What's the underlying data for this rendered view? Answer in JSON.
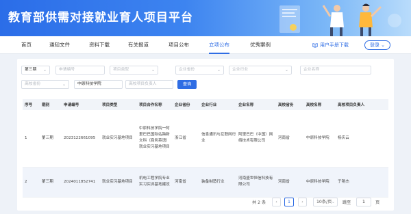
{
  "header": {
    "title": "教育部供需对接就业育人项目平台"
  },
  "nav": {
    "items": [
      "首页",
      "通知文件",
      "资料下载",
      "有关报道",
      "项目公布",
      "立项公布",
      "优秀案例"
    ],
    "active_index": 5,
    "manual_label": "用户手册下载",
    "login_label": "登录"
  },
  "filters": {
    "batch": "第三期",
    "apply_no": "申请编号",
    "project_type": "项目类型",
    "enterprise_province": "企业省份",
    "enterprise_industry": "企业行业",
    "enterprise_name": "企业名称",
    "school_province": "高校省份",
    "school_name": "中原科技学院",
    "school_leader": "高校项目负责人",
    "search_label": "查询"
  },
  "table": {
    "headers": [
      "序号",
      "期别",
      "申请编号",
      "项目类型",
      "项目合作名称",
      "企业省份",
      "企业行业",
      "企业名称",
      "高校省份",
      "高校名称",
      "高校项目负责人"
    ],
    "rows": [
      [
        "1",
        "第三期",
        "2023122661095",
        "就业实习基地项目",
        "中原科技学院一阿里巴巴国际站跨新文科（商务英语）就业实习基地项目",
        "浙江省",
        "信息通讯与互联网行业",
        "阿里巴巴（中国）网络技术有限公司",
        "河南省",
        "中原科技学院",
        "杨庆云"
      ],
      [
        "2",
        "第三期",
        "2024011852741",
        "就业实习基地项目",
        "机电工程学院专业实习实训基地建设",
        "河南省",
        "装备制造行业",
        "河南盛世恒信科技有限公司",
        "河南省",
        "中原科技学院",
        "于艳杰"
      ]
    ]
  },
  "pagination": {
    "total_text": "共 2 条",
    "prev": "‹",
    "current": "1",
    "next": "›",
    "page_size": "10条/页",
    "goto_label": "跳至",
    "goto_value": "1",
    "page_unit": "页"
  },
  "icons": {
    "manual": "book-icon",
    "caret": "chevron-down-icon"
  },
  "colors": {
    "accent": "#2f6de4",
    "banner_start": "#2b6de8",
    "banner_end": "#b9dcfb"
  }
}
